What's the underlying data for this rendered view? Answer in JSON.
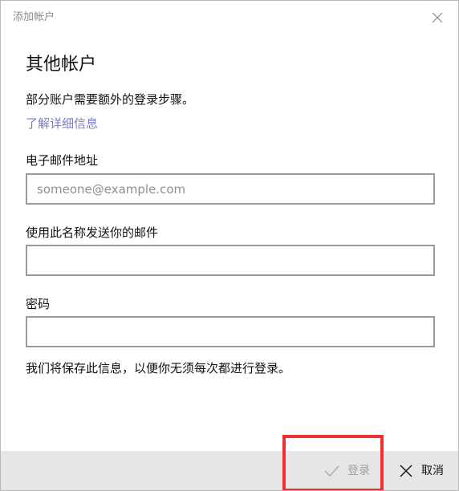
{
  "window": {
    "title": "添加帐户"
  },
  "main": {
    "heading": "其他帐户",
    "description": "部分账户需要额外的登录步骤。",
    "learn_more": "了解详细信息"
  },
  "fields": {
    "email": {
      "label": "电子邮件地址",
      "value": "",
      "placeholder": "someone@example.com"
    },
    "display_name": {
      "label": "使用此名称发送你的邮件",
      "value": "",
      "placeholder": ""
    },
    "password": {
      "label": "密码",
      "value": "",
      "placeholder": ""
    }
  },
  "note": "我们将保存此信息，以便你无须每次都进行登录。",
  "footer": {
    "signin_label": "登录",
    "cancel_label": "取消"
  },
  "icons": {
    "close": "close-icon",
    "checkmark": "checkmark-icon",
    "cancel": "close-icon"
  },
  "colors": {
    "link": "#7b7dc4",
    "footer_bg": "#e6e6e6",
    "disabled_text": "#a0a0a0",
    "highlight": "#ee3030",
    "input_border": "#9a9a9a"
  }
}
